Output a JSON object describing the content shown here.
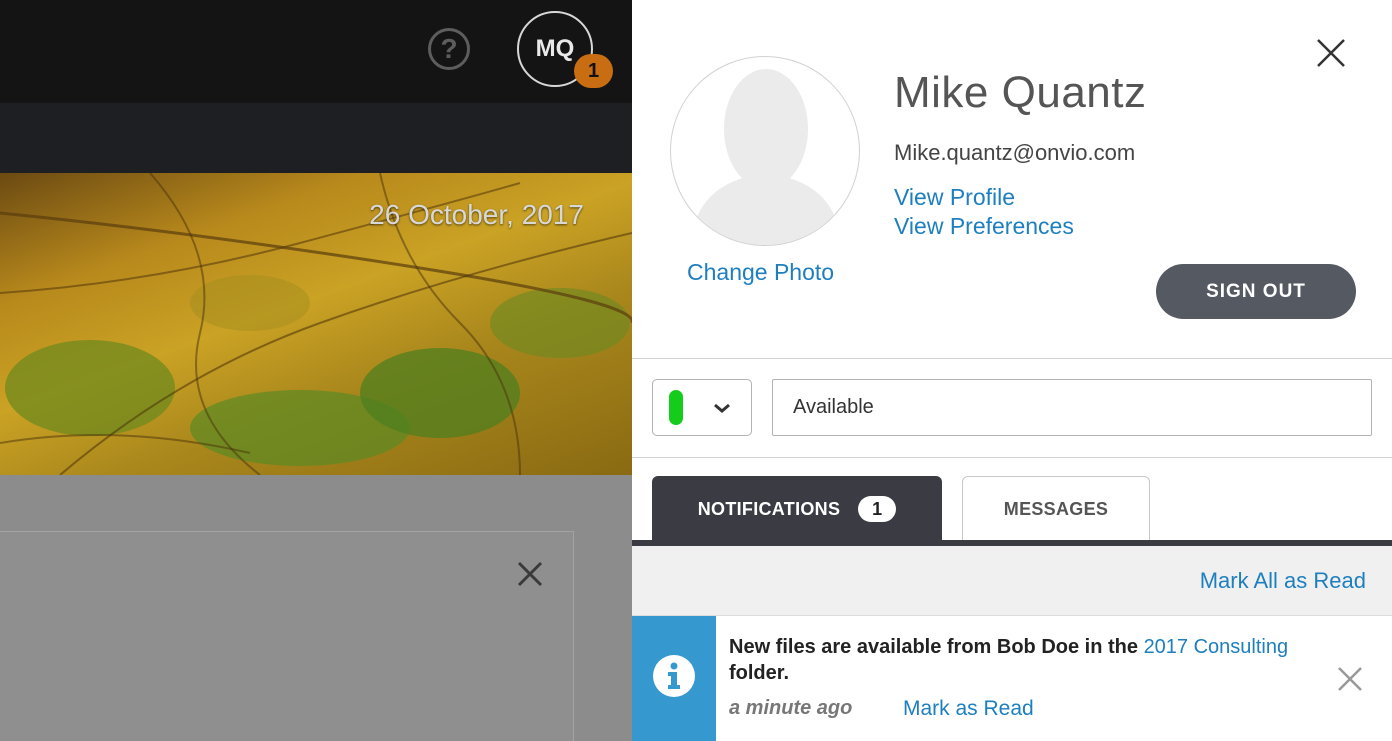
{
  "background_app": {
    "help_icon": "question-circle-icon",
    "avatar_initials": "MQ",
    "avatar_badge": "1",
    "hero_date": "26 October, 2017",
    "card_close_icon": "close-icon"
  },
  "panel": {
    "close_icon": "close-icon",
    "photo_icon": "user-silhouette-icon",
    "change_photo": "Change Photo",
    "name": "Mike Quantz",
    "email": "Mike.quantz@onvio.com",
    "view_profile": "View Profile",
    "view_preferences": "View Preferences",
    "sign_out": "SIGN OUT",
    "status": {
      "indicator_color": "#16cc1a",
      "value": "Available"
    },
    "tabs": [
      {
        "label": "NOTIFICATIONS",
        "count": "1",
        "active": true
      },
      {
        "label": "MESSAGES",
        "active": false
      }
    ],
    "mark_all": "Mark All as Read",
    "notification": {
      "icon": "info-icon",
      "text_before": "New files are available from Bob Doe in the ",
      "link_text": "2017 Consulting",
      "text_after": " folder.",
      "time": "a minute ago",
      "mark_read": "Mark as Read"
    }
  },
  "colors": {
    "accent_link": "#1d7fbf",
    "dark_tab": "#3b3c43",
    "info_strip": "#3598cf",
    "badge": "#c86d12"
  }
}
